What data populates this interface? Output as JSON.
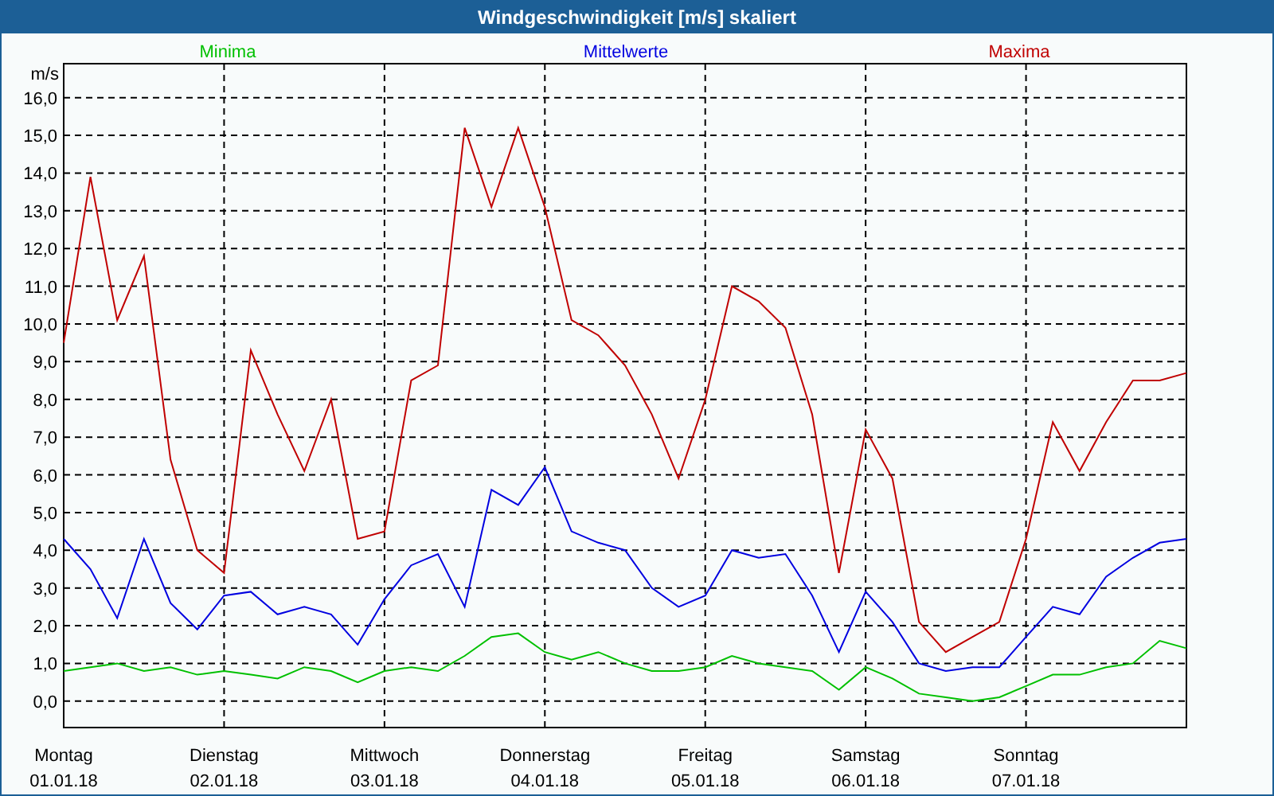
{
  "window": {
    "title": "Windgeschwindigkeit [m/s] skaliert"
  },
  "chart": {
    "date_labels": [
      "01.01.18",
      "02.01.18",
      "03.01.18",
      "04.01.18",
      "05.01.18",
      "06.01.18",
      "07.01.18"
    ],
    "chart_data": {
      "type": "line",
      "grid": true,
      "ylabel": "m/s",
      "categories": [
        "Montag",
        null,
        null,
        null,
        null,
        null,
        "Dienstag",
        null,
        null,
        null,
        null,
        null,
        "Mittwoch",
        null,
        null,
        null,
        null,
        null,
        "Donnerstag",
        null,
        null,
        null,
        null,
        null,
        "Freitag",
        null,
        null,
        null,
        null,
        null,
        "Samstag",
        null,
        null,
        null,
        null,
        null,
        "Sonntag",
        null,
        null,
        null,
        null,
        null,
        null
      ],
      "ylim": [
        -0.7,
        16.9
      ],
      "yticks": [
        {
          "value": 0,
          "label": "0,0"
        },
        {
          "value": 1,
          "label": "1,0"
        },
        {
          "value": 2,
          "label": "2,0"
        },
        {
          "value": 3,
          "label": "3,0"
        },
        {
          "value": 4,
          "label": "4,0"
        },
        {
          "value": 5,
          "label": "5,0"
        },
        {
          "value": 6,
          "label": "6,0"
        },
        {
          "value": 7,
          "label": "7,0"
        },
        {
          "value": 8,
          "label": "8,0"
        },
        {
          "value": 9,
          "label": "9,0"
        },
        {
          "value": 10,
          "label": "10,0"
        },
        {
          "value": 11,
          "label": "11,0"
        },
        {
          "value": 12,
          "label": "12,0"
        },
        {
          "value": 13,
          "label": "13,0"
        },
        {
          "value": 14,
          "label": "14,0"
        },
        {
          "value": 15,
          "label": "15,0"
        },
        {
          "value": 16,
          "label": "16,0"
        }
      ],
      "series": [
        {
          "name": "Minima",
          "color": "#00c000",
          "values": [
            0.8,
            0.9,
            1.0,
            0.8,
            0.9,
            0.7,
            0.8,
            0.7,
            0.6,
            0.9,
            0.8,
            0.5,
            0.8,
            0.9,
            0.8,
            1.2,
            1.7,
            1.8,
            1.3,
            1.1,
            1.3,
            1.0,
            0.8,
            0.8,
            0.9,
            1.2,
            1.0,
            0.9,
            0.8,
            0.3,
            0.9,
            0.6,
            0.2,
            0.1,
            0.0,
            0.1,
            0.4,
            0.7,
            0.7,
            0.9,
            1.0,
            1.6,
            1.4
          ]
        },
        {
          "name": "Mittelwerte",
          "color": "#0000e0",
          "values": [
            4.3,
            3.5,
            2.2,
            4.3,
            2.6,
            1.9,
            2.8,
            2.9,
            2.3,
            2.5,
            2.3,
            1.5,
            2.7,
            3.6,
            3.9,
            2.5,
            5.6,
            5.2,
            6.2,
            4.5,
            4.2,
            4.0,
            3.0,
            2.5,
            2.8,
            4.0,
            3.8,
            3.9,
            2.8,
            1.3,
            2.9,
            2.1,
            1.0,
            0.8,
            0.9,
            0.9,
            1.7,
            2.5,
            2.3,
            3.3,
            3.8,
            4.2,
            4.3
          ]
        },
        {
          "name": "Maxima",
          "color": "#c00000",
          "values": [
            9.5,
            13.9,
            10.1,
            11.8,
            6.4,
            4.0,
            3.4,
            9.3,
            7.6,
            6.1,
            8.0,
            4.3,
            4.5,
            8.5,
            8.9,
            15.2,
            13.1,
            15.2,
            13.1,
            10.1,
            9.7,
            8.9,
            7.6,
            5.9,
            8.0,
            11.0,
            10.6,
            9.9,
            7.6,
            3.4,
            7.2,
            5.9,
            2.1,
            1.3,
            1.7,
            2.1,
            4.3,
            7.4,
            6.1,
            7.4,
            8.5,
            8.5,
            8.7
          ]
        }
      ]
    }
  }
}
